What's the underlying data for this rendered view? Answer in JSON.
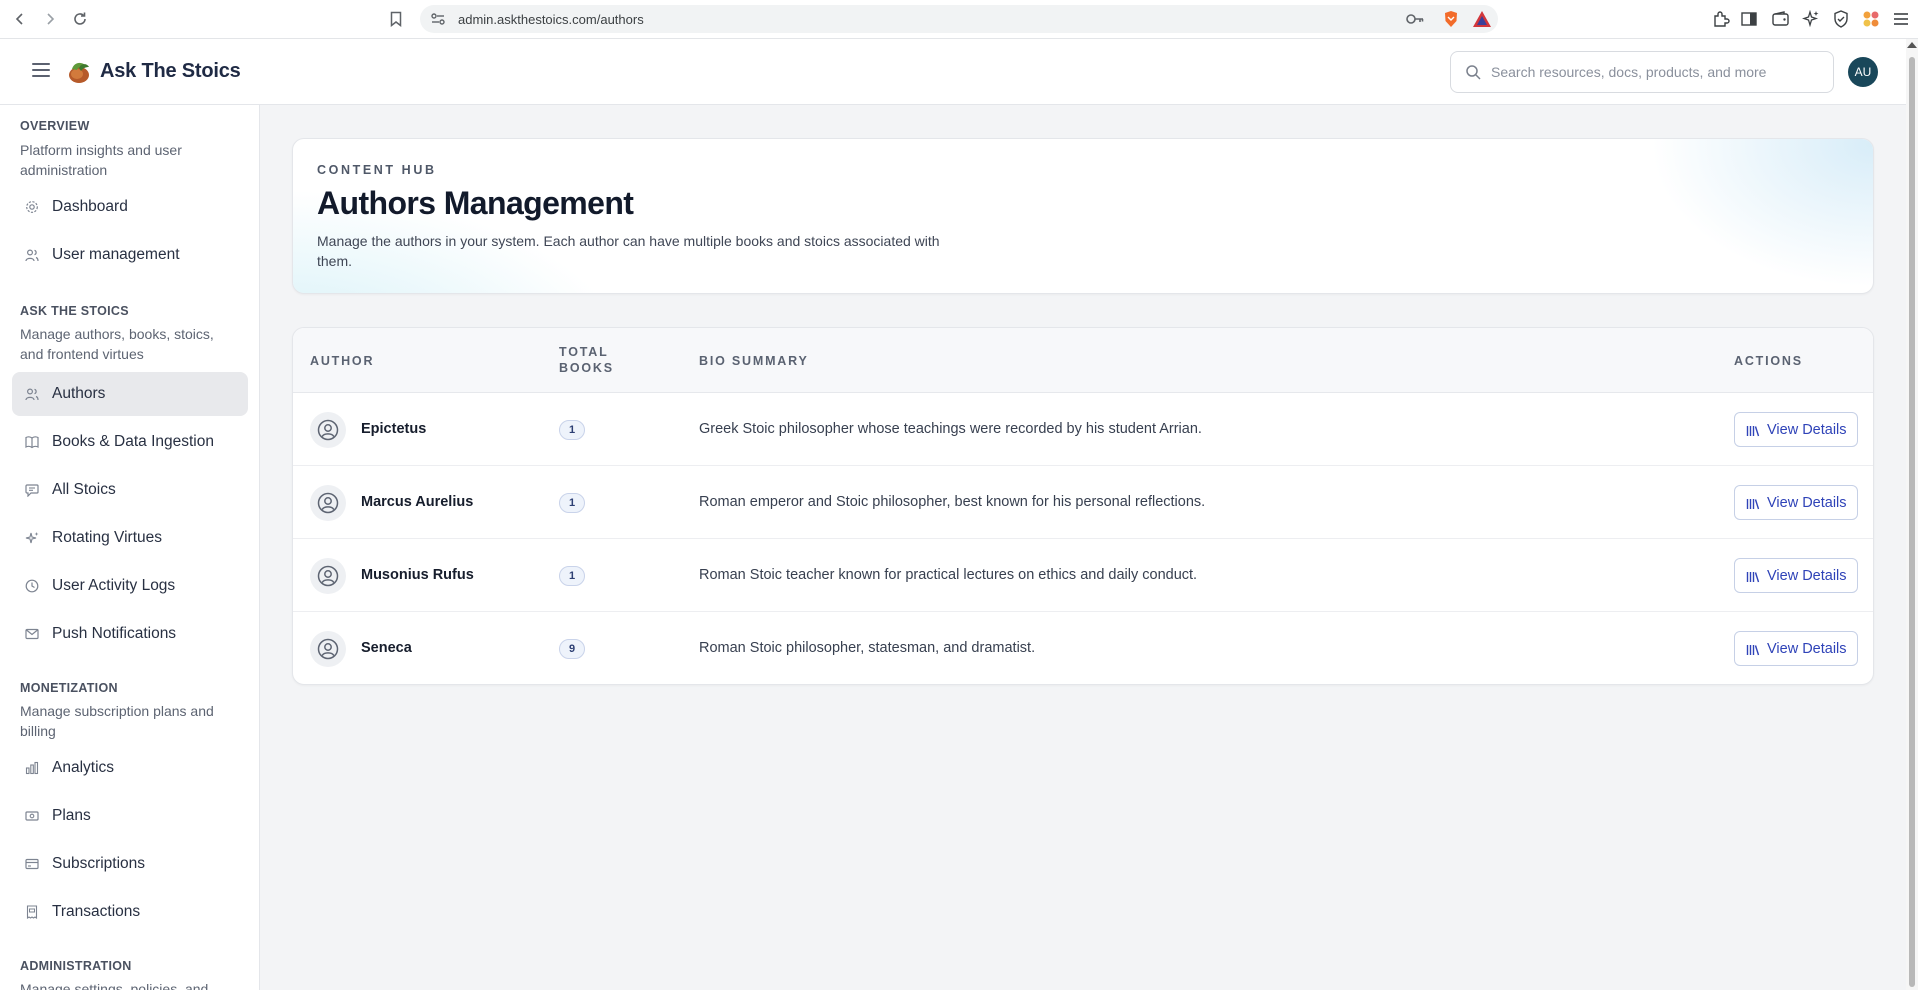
{
  "browser": {
    "url": "admin.askthestoics.com/authors"
  },
  "header": {
    "brand": "Ask The Stoics",
    "search_placeholder": "Search resources, docs, products, and more",
    "avatar_initials": "AU"
  },
  "sidebar": {
    "overview": {
      "title": "OVERVIEW",
      "desc": "Platform insights and user administration",
      "items": [
        {
          "label": "Dashboard",
          "icon": "gear-icon"
        },
        {
          "label": "User management",
          "icon": "users-icon"
        }
      ]
    },
    "stoics": {
      "title": "ASK THE STOICS",
      "desc": "Manage authors, books, stoics, and frontend virtues",
      "items": [
        {
          "label": "Authors",
          "icon": "users-icon",
          "active": true
        },
        {
          "label": "Books & Data Ingestion",
          "icon": "book-icon"
        },
        {
          "label": "All Stoics",
          "icon": "chat-icon"
        },
        {
          "label": "Rotating Virtues",
          "icon": "sparkle-icon"
        },
        {
          "label": "User Activity Logs",
          "icon": "clock-icon"
        },
        {
          "label": "Push Notifications",
          "icon": "mail-icon"
        }
      ]
    },
    "monetization": {
      "title": "MONETIZATION",
      "desc": "Manage subscription plans and billing",
      "items": [
        {
          "label": "Analytics",
          "icon": "bar-chart-icon"
        },
        {
          "label": "Plans",
          "icon": "money-icon"
        },
        {
          "label": "Subscriptions",
          "icon": "card-icon"
        },
        {
          "label": "Transactions",
          "icon": "receipt-icon"
        }
      ]
    },
    "administration": {
      "title": "ADMINISTRATION",
      "desc": "Manage settings, policies, and"
    }
  },
  "hero": {
    "eyebrow": "CONTENT HUB",
    "title": "Authors Management",
    "description": "Manage the authors in your system. Each author can have multiple books and stoics associated with them."
  },
  "table": {
    "headers": {
      "author": "AUTHOR",
      "total_books": "TOTAL BOOKS",
      "bio": "BIO SUMMARY",
      "actions": "ACTIONS"
    },
    "action_label": "View Details",
    "rows": [
      {
        "name": "Epictetus",
        "books": "1",
        "bio": "Greek Stoic philosopher whose teachings were recorded by his student Arrian."
      },
      {
        "name": "Marcus Aurelius",
        "books": "1",
        "bio": "Roman emperor and Stoic philosopher, best known for his personal reflections."
      },
      {
        "name": "Musonius Rufus",
        "books": "1",
        "bio": "Roman Stoic teacher known for practical lectures on ethics and daily conduct."
      },
      {
        "name": "Seneca",
        "books": "9",
        "bio": "Roman Stoic philosopher, statesman, and dramatist."
      }
    ]
  }
}
